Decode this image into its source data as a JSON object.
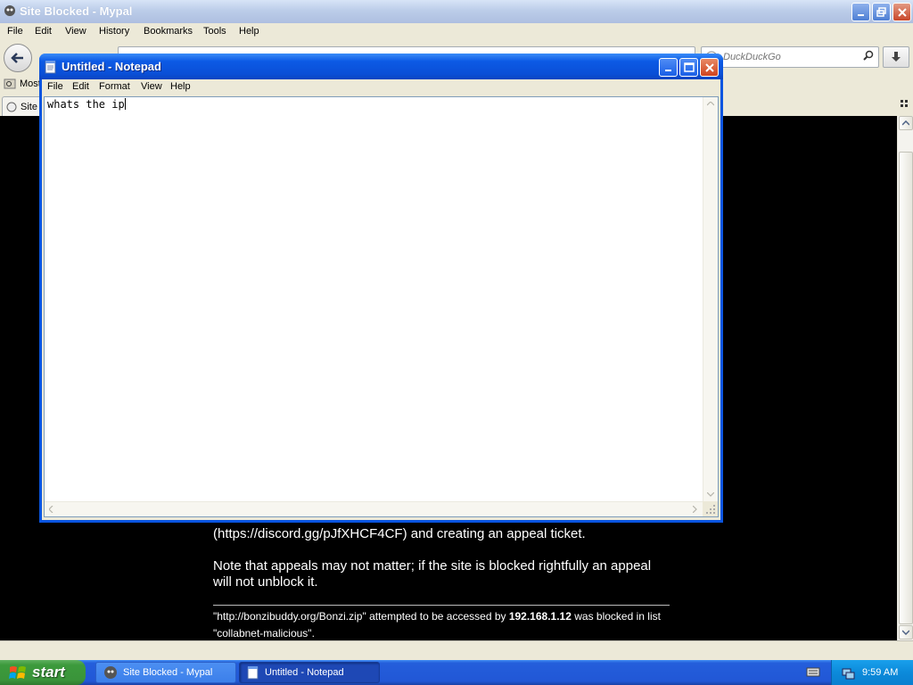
{
  "browser": {
    "title": "Site Blocked - Mypal",
    "menu": [
      "File",
      "Edit",
      "View",
      "History",
      "Bookmarks",
      "Tools",
      "Help"
    ],
    "search_placeholder": "DuckDuckGo",
    "bookmark_label": "Most",
    "tab_label": "Site",
    "content": {
      "line1": "(https://discord.gg/pJfXHCF4CF) and creating an appeal ticket.",
      "note": "Note that appeals may not matter; if the site is blocked rightfully an appeal will not unblock it.",
      "blocked_prefix": "\"http://bonzibuddy.org/Bonzi.zip\" attempted to be accessed by ",
      "blocked_ip": "192.168.1.12",
      "blocked_suffix": " was blocked in list \"collabnet-malicious\"."
    }
  },
  "notepad": {
    "title": "Untitled - Notepad",
    "menu": [
      "File",
      "Edit",
      "Format",
      "View",
      "Help"
    ],
    "text": "whats the ip"
  },
  "taskbar": {
    "start_label": "start",
    "tasks": [
      {
        "label": "Site Blocked - Mypal",
        "active": false
      },
      {
        "label": "Untitled - Notepad",
        "active": true
      }
    ],
    "clock": "9:59 AM"
  },
  "colors": {
    "xp_blue": "#0a55e0",
    "start_green": "#3c9a3c",
    "tray_blue": "#0c8ada"
  }
}
